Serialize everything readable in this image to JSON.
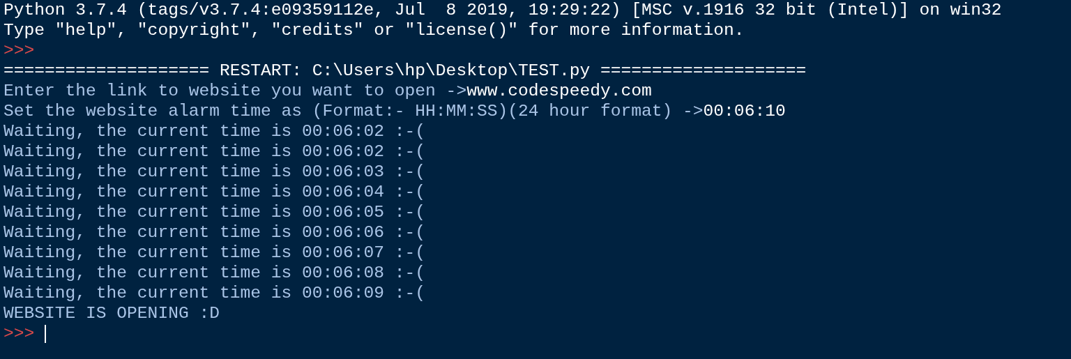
{
  "shell": {
    "lines": [
      {
        "segments": [
          {
            "kind": "banner",
            "text": "Python 3.7.4 (tags/v3.7.4:e09359112e, Jul  8 2019, 19:29:22) [MSC v.1916 32 bit (Intel)] on win32"
          }
        ]
      },
      {
        "segments": [
          {
            "kind": "banner",
            "text": "Type \"help\", \"copyright\", \"credits\" or \"license()\" for more information."
          }
        ]
      },
      {
        "segments": [
          {
            "kind": "prompt",
            "text": ">>>"
          }
        ]
      },
      {
        "segments": [
          {
            "kind": "banner",
            "text": "==================== RESTART: C:\\Users\\hp\\Desktop\\TEST.py ===================="
          }
        ]
      },
      {
        "segments": [
          {
            "kind": "stdout",
            "text": "Enter the link to website you want to open ->"
          },
          {
            "kind": "input",
            "text": "www.codespeedy.com"
          }
        ]
      },
      {
        "segments": [
          {
            "kind": "stdout",
            "text": "Set the website alarm time as (Format:- HH:MM:SS)(24 hour format) ->"
          },
          {
            "kind": "input",
            "text": "00:06:10"
          }
        ]
      },
      {
        "segments": [
          {
            "kind": "stdout",
            "text": "Waiting, the current time is 00:06:02 :-("
          }
        ]
      },
      {
        "segments": [
          {
            "kind": "stdout",
            "text": "Waiting, the current time is 00:06:02 :-("
          }
        ]
      },
      {
        "segments": [
          {
            "kind": "stdout",
            "text": "Waiting, the current time is 00:06:03 :-("
          }
        ]
      },
      {
        "segments": [
          {
            "kind": "stdout",
            "text": "Waiting, the current time is 00:06:04 :-("
          }
        ]
      },
      {
        "segments": [
          {
            "kind": "stdout",
            "text": "Waiting, the current time is 00:06:05 :-("
          }
        ]
      },
      {
        "segments": [
          {
            "kind": "stdout",
            "text": "Waiting, the current time is 00:06:06 :-("
          }
        ]
      },
      {
        "segments": [
          {
            "kind": "stdout",
            "text": "Waiting, the current time is 00:06:07 :-("
          }
        ]
      },
      {
        "segments": [
          {
            "kind": "stdout",
            "text": "Waiting, the current time is 00:06:08 :-("
          }
        ]
      },
      {
        "segments": [
          {
            "kind": "stdout",
            "text": "Waiting, the current time is 00:06:09 :-("
          }
        ]
      },
      {
        "segments": [
          {
            "kind": "stdout",
            "text": "WEBSITE IS OPENING :D"
          }
        ]
      },
      {
        "segments": [
          {
            "kind": "prompt",
            "text": ">>>"
          }
        ],
        "cursor": true
      }
    ]
  }
}
